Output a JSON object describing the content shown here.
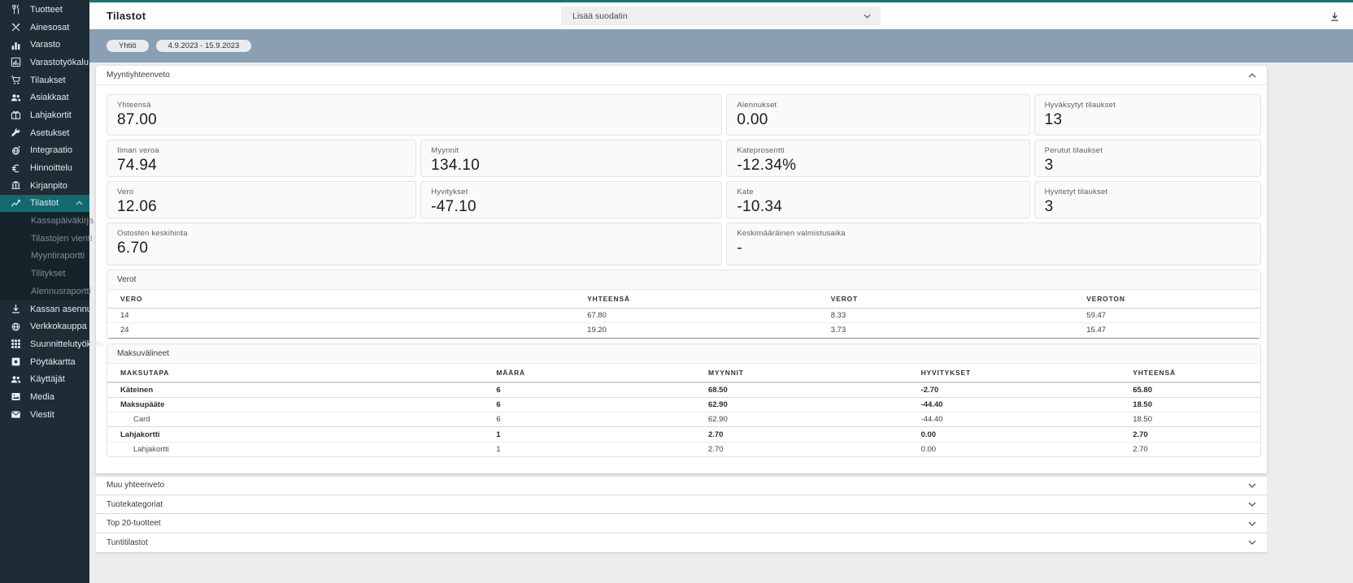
{
  "colors": {
    "accent": "#1c7376",
    "sidebar_bg": "#1e2c35",
    "active_item_bg": "#136a6e",
    "filterbar_bg": "#8b9fb3"
  },
  "sidebar": {
    "items": [
      {
        "label": "Tuotteet",
        "icon": "utensils-icon"
      },
      {
        "label": "Ainesosat",
        "icon": "crossed-utensils-icon"
      },
      {
        "label": "Varasto",
        "icon": "bar-chart-icon"
      },
      {
        "label": "Varastotyökalu",
        "icon": "chart-box-icon"
      },
      {
        "label": "Tilaukset",
        "icon": "cart-icon"
      },
      {
        "label": "Asiakkaat",
        "icon": "users-icon"
      },
      {
        "label": "Lahjakortit",
        "icon": "gift-card-icon"
      },
      {
        "label": "Asetukset",
        "icon": "wrench-icon"
      },
      {
        "label": "Integraatio",
        "icon": "integration-globe-icon"
      },
      {
        "label": "Hinnoittelu",
        "icon": "euro-icon"
      },
      {
        "label": "Kirjanpito",
        "icon": "bank-icon"
      },
      {
        "label": "Tilastot",
        "icon": "line-chart-icon",
        "active": true,
        "expanded": true
      },
      {
        "label": "Kassan asennus",
        "icon": "download-icon"
      },
      {
        "label": "Verkkokauppa",
        "icon": "globe-icon"
      },
      {
        "label": "Suunnittelutyökalu",
        "icon": "grid-icon"
      },
      {
        "label": "Pöytäkartta",
        "icon": "table-map-icon"
      },
      {
        "label": "Käyttäjät",
        "icon": "users-icon"
      },
      {
        "label": "Media",
        "icon": "image-icon"
      },
      {
        "label": "Viestit",
        "icon": "envelope-icon"
      }
    ],
    "submenu": [
      "Kassapäiväkirja",
      "Tilastojen vienti",
      "Myyntiraportti",
      "Tilitykset",
      "Alennusraportti"
    ]
  },
  "header": {
    "title": "Tilastot",
    "filter_placeholder": "Lisää suodatin"
  },
  "filters": {
    "chips": [
      "Yhtiö",
      "4.9.2023 - 15.9.2023"
    ]
  },
  "summary": {
    "title": "Myyntiyhteenveto",
    "cards": [
      {
        "label": "Yhteensä",
        "value": "87.00"
      },
      {
        "label": "Alennukset",
        "value": "0.00"
      },
      {
        "label": "Hyväksytyt tilaukset",
        "value": "13"
      },
      {
        "label": "Ilman veroa",
        "value": "74.94"
      },
      {
        "label": "Myynnit",
        "value": "134.10"
      },
      {
        "label": "Kateprosentti",
        "value": "-12.34%"
      },
      {
        "label": "Perutut tilaukset",
        "value": "3"
      },
      {
        "label": "Vero",
        "value": "12.06"
      },
      {
        "label": "Hyvitykset",
        "value": "-47.10"
      },
      {
        "label": "Kate",
        "value": "-10.34"
      },
      {
        "label": "Hyvitetyt tilaukset",
        "value": "3"
      },
      {
        "label": "Ostosten keskihinta",
        "value": "6.70"
      },
      {
        "label": "Keskimääräinen valmistusaika",
        "value": "-"
      }
    ]
  },
  "verot": {
    "title": "Verot",
    "headers": [
      "VERO",
      "YHTEENSÄ",
      "VEROT",
      "VEROTON"
    ],
    "rows": [
      [
        "14",
        "67.80",
        "8.33",
        "59.47"
      ],
      [
        "24",
        "19.20",
        "3.73",
        "15.47"
      ]
    ]
  },
  "maksuvalineet": {
    "title": "Maksuvälineet",
    "headers": [
      "MAKSUTAPA",
      "MÄÄRÄ",
      "MYYNNIT",
      "HYVITYKSET",
      "YHTEENSÄ"
    ],
    "rows": [
      {
        "cells": [
          "Käteinen",
          "6",
          "68.50",
          "-2.70",
          "65.80"
        ],
        "style": "bold"
      },
      {
        "cells": [
          "Maksupääte",
          "6",
          "62.90",
          "-44.40",
          "18.50"
        ],
        "style": "bold"
      },
      {
        "cells": [
          "Card",
          "6",
          "62.90",
          "-44.40",
          "18.50"
        ],
        "style": "indent"
      },
      {
        "cells": [
          "Lahjakortti",
          "1",
          "2.70",
          "0.00",
          "2.70"
        ],
        "style": "bold"
      },
      {
        "cells": [
          "Lahjakortti",
          "1",
          "2.70",
          "0.00",
          "2.70"
        ],
        "style": "indent"
      }
    ]
  },
  "accordions": {
    "items": [
      "Muu yhteenveto",
      "Tuotekategoriat",
      "Top 20-tuotteet",
      "Tuntitilastot"
    ]
  }
}
